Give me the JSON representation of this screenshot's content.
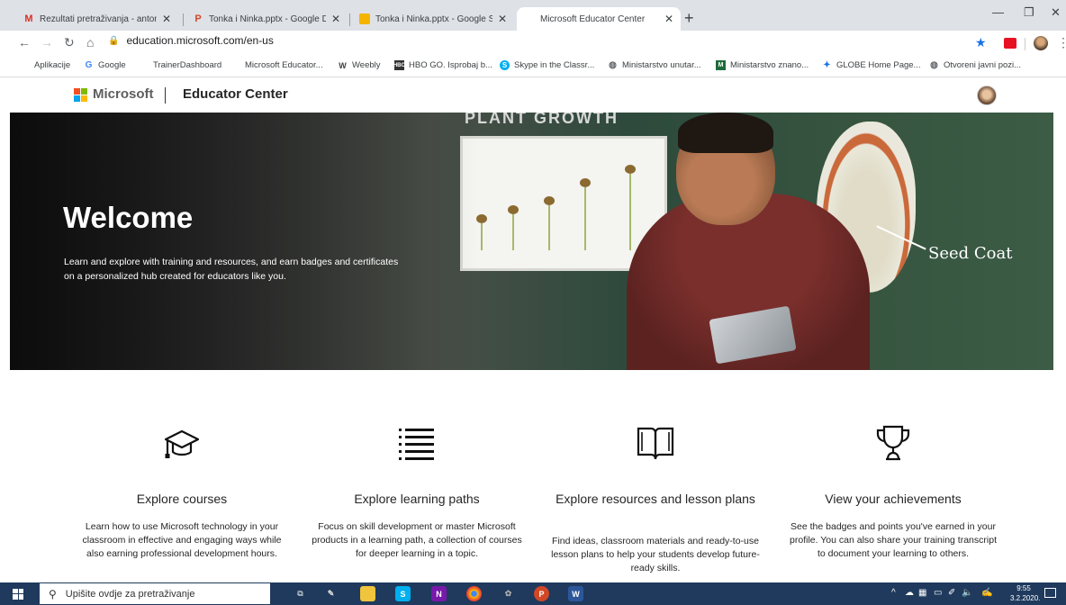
{
  "browser": {
    "tabs": [
      {
        "title": "Rezultati pretraživanja - antonija",
        "favicon": "gmail-icon"
      },
      {
        "title": "Tonka i Ninka.pptx - Google Drive",
        "favicon": "powerpoint-icon"
      },
      {
        "title": "Tonka i Ninka.pptx - Google Slides",
        "favicon": "slides-icon"
      },
      {
        "title": "Microsoft Educator Center",
        "favicon": "microsoft-icon",
        "active": true
      }
    ],
    "new_tab_label": "+",
    "url": "education.microsoft.com/en-us",
    "bookmarks": [
      {
        "label": "Aplikacije",
        "icon": "apps-grid-icon"
      },
      {
        "label": "Google",
        "icon": "google-icon"
      },
      {
        "label": "TrainerDashboard",
        "icon": "microsoft-icon"
      },
      {
        "label": "Microsoft Educator...",
        "icon": "microsoft-icon"
      },
      {
        "label": "Weebly",
        "icon": "weebly-icon"
      },
      {
        "label": "HBO GO. Isprobaj b...",
        "icon": "hbo-icon"
      },
      {
        "label": "Skype in the Classr...",
        "icon": "skype-icon"
      },
      {
        "label": "Ministarstvo unutar...",
        "icon": "globe-icon"
      },
      {
        "label": "Ministarstvo znano...",
        "icon": "ministry-icon"
      },
      {
        "label": "GLOBE Home Page...",
        "icon": "globe-program-icon"
      },
      {
        "label": "Otvoreni javni pozi...",
        "icon": "globe-icon"
      }
    ]
  },
  "site": {
    "brand": "Microsoft",
    "section": "Educator Center",
    "hero": {
      "title": "Welcome",
      "subtitle": "Learn and explore with training and resources, and earn badges and certificates on a personalized hub created for educators like you.",
      "board_heading": "PLANT GROWTH",
      "board_label": "Seed Coat"
    },
    "cards": [
      {
        "icon": "graduation-cap-icon",
        "title": "Explore courses",
        "desc": "Learn how to use Microsoft technology in your classroom in effective and engaging ways while also earning professional development hours."
      },
      {
        "icon": "list-icon",
        "title": "Explore learning paths",
        "desc": "Focus on skill development or master Microsoft products in a learning path, a collection of courses for deeper learning in a topic."
      },
      {
        "icon": "book-icon",
        "title": "Explore resources and lesson plans",
        "desc": "Find ideas, classroom materials and ready-to-use lesson plans to help your students develop future-ready skills."
      },
      {
        "icon": "trophy-icon",
        "title": "View your achievements",
        "desc": "See the badges and points you've earned in your profile. You can also share your training transcript to document your learning to others."
      }
    ]
  },
  "taskbar": {
    "search_placeholder": "Upišite ovdje za pretraživanje",
    "time": "9:55",
    "date": "3.2.2020."
  }
}
